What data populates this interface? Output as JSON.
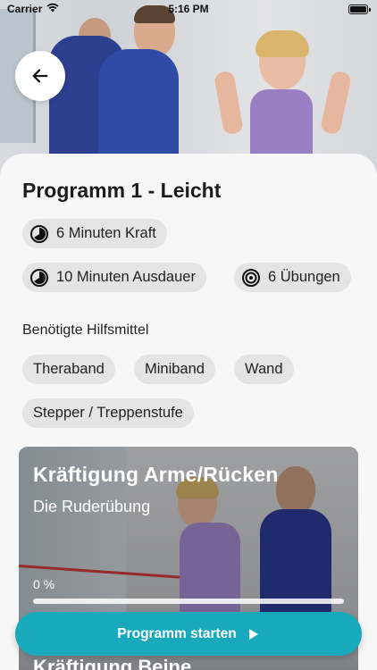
{
  "status_bar": {
    "carrier": "Carrier",
    "time": "5:16 PM"
  },
  "program": {
    "title": "Programm 1 - Leicht",
    "stats": [
      {
        "icon": "timer-icon",
        "label": "6 Minuten Kraft"
      },
      {
        "icon": "timer-icon",
        "label": "10 Minuten Ausdauer"
      },
      {
        "icon": "exercises-icon",
        "label": "6 Übungen"
      }
    ],
    "equipment_heading": "Benötigte Hilfsmittel",
    "equipment": [
      "Theraband",
      "Miniband",
      "Wand",
      "Stepper / Treppenstufe"
    ]
  },
  "exercises": [
    {
      "title": "Kräftigung Arme/Rücken",
      "subtitle": "Die Ruderübung",
      "progress_label": "0 %",
      "progress": 0
    },
    {
      "title": "Kräftigung Beine"
    }
  ],
  "start_button": {
    "label": "Programm starten"
  },
  "colors": {
    "accent": "#19a9bd",
    "chip_bg": "#e4e4e4",
    "sheet_bg": "#f7f7f7"
  }
}
